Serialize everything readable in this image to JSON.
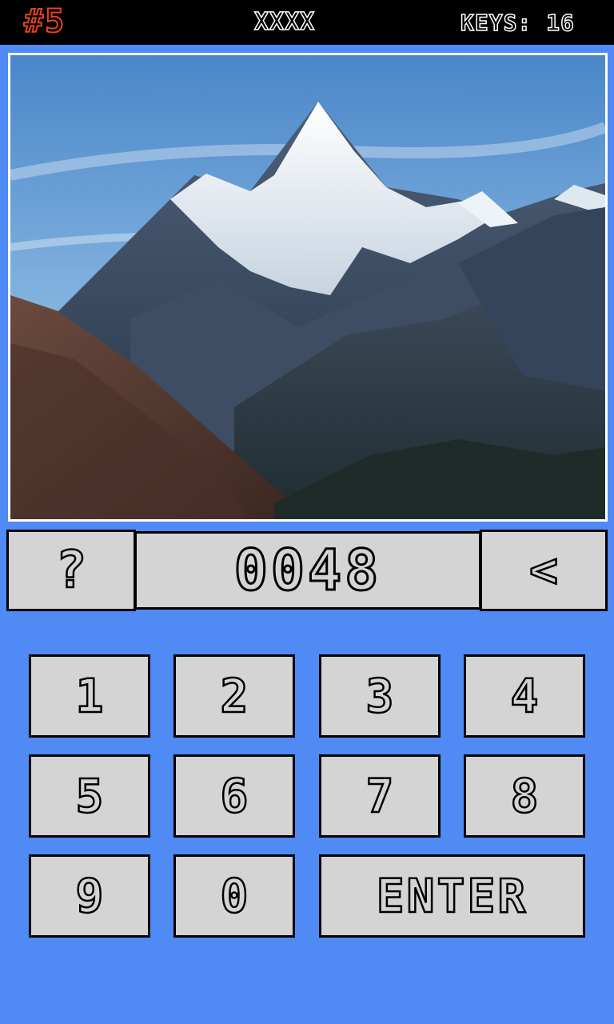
{
  "hud": {
    "level": "#5",
    "stars": "XXXX",
    "keys": "KEYS: 16"
  },
  "photo": {
    "subject": "snow-capped mountain peak with valley"
  },
  "controls": {
    "hint_label": "?",
    "code_display": "0048",
    "backspace_label": "<"
  },
  "keypad": {
    "k1": "1",
    "k2": "2",
    "k3": "3",
    "k4": "4",
    "k5": "5",
    "k6": "6",
    "k7": "7",
    "k8": "8",
    "k9": "9",
    "k0": "0",
    "enter": "ENTER"
  },
  "colors": {
    "background": "#4f8af5",
    "button": "#d4d4d4",
    "level_accent": "#e8431c",
    "topbar": "#000000"
  }
}
